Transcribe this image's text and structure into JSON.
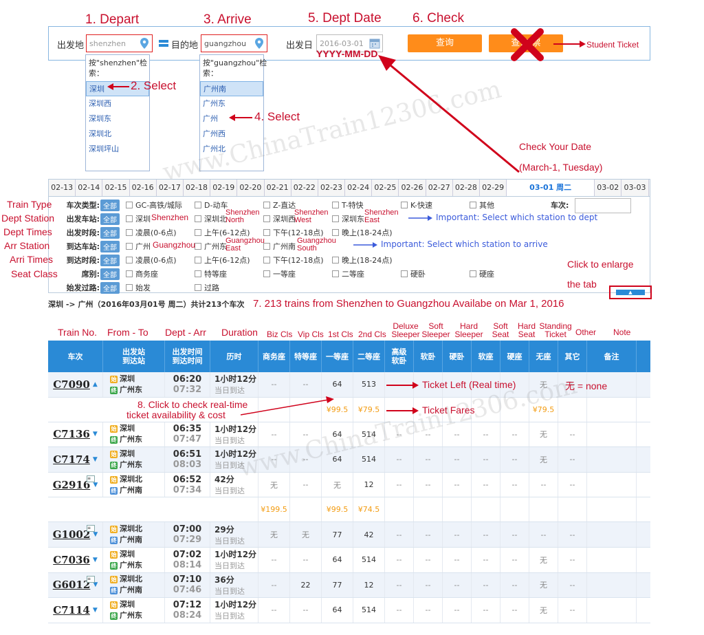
{
  "annotations": {
    "step1": "1. Depart",
    "step2": "2. Select",
    "step3": "3. Arrive",
    "step4": "4. Select",
    "step5": "5. Dept Date",
    "step6": "6. Check",
    "student_ticket": "Student Ticket",
    "date_format": "YYYY-MM-DD",
    "check_date_1": "Check Your  Date",
    "check_date_2": "(March-1, Tuesday)",
    "enlarge_1": "Click to enlarge",
    "enlarge_2": "the tab",
    "step7": "7.  213 trains from Shenzhen to Guangzhou Availabe on Mar 1, 2016",
    "step8_1": "8. Click to check real-time",
    "step8_2": "ticket availability & cost",
    "ticket_left": "Ticket Left (Real time)",
    "ticket_fares": "Ticket Fares",
    "none_mark": "无  =  none",
    "important_dept": "Important: Select which station to dept",
    "important_arr": "Important: Select which station to arrive",
    "row_labels": [
      "Train Type",
      "Dept Station",
      "Dept Times",
      "Arr Station",
      "Arri Times",
      "Seat Class"
    ],
    "station_notes": [
      "Shenzhen",
      "Shenzhen North",
      "Shenzhen West",
      "Shenzhen East",
      "Guangzhou",
      "Guangzhou East",
      "Guangzhou South"
    ],
    "col_notes": [
      "Train No.",
      "From - To",
      "Dept - Arr",
      "Duration",
      "Biz Cls",
      "Vip Cls",
      "1st Cls",
      "2nd Cls",
      "Deluxe Sleeper",
      "Soft Sleeper",
      "Hard Sleeper",
      "Soft Seat",
      "Hard Seat",
      "Standing Ticket",
      "Other",
      "Note"
    ],
    "watermark": "www.ChinaTrain12306.com"
  },
  "search": {
    "from_label": "出发地",
    "to_label": "目的地",
    "date_label": "出发日",
    "from_value": "shenzhen",
    "to_value": "guangzhou",
    "date_value": "2016-03-01",
    "query_button": "查询",
    "student_button": "查询学生票",
    "student_button_visible": "查询   票"
  },
  "from_dropdown": {
    "hint": "按\"shenzhen\"检索：",
    "items": [
      "深圳",
      "深圳西",
      "深圳东",
      "深圳北",
      "深圳坪山"
    ]
  },
  "to_dropdown": {
    "hint": "按\"guangzhou\"检索：",
    "items": [
      "广州南",
      "广州东",
      "广州",
      "广州西",
      "广州北"
    ]
  },
  "date_tabs": [
    "02-13",
    "02-14",
    "02-15",
    "02-16",
    "02-17",
    "02-18",
    "02-19",
    "02-20",
    "02-21",
    "02-22",
    "02-23",
    "02-24",
    "02-25",
    "02-26",
    "02-27",
    "02-28",
    "02-29",
    "03-01 周二",
    "03-02",
    "03-03"
  ],
  "filters": {
    "all": "全部",
    "train_type_label": "车次类型:",
    "train_types": [
      "GC-高铁/城际",
      "D-动车",
      "Z-直达",
      "T-特快",
      "K-快速",
      "其他"
    ],
    "train_no_label": "车次:",
    "dept_station_label": "出发车站:",
    "dept_stations": [
      "深圳",
      "深圳北",
      "深圳西",
      "深圳东"
    ],
    "dept_time_label": "出发时段:",
    "times": [
      "凌晨(0-6点)",
      "上午(6-12点)",
      "下午(12-18点)",
      "晚上(18-24点)"
    ],
    "arr_station_label": "到达车站:",
    "arr_stations": [
      "广州",
      "广州东",
      "广州南"
    ],
    "arr_time_label": "到达时段:",
    "seat_label": "席别:",
    "seats": [
      "商务座",
      "特等座",
      "一等座",
      "二等座",
      "硬卧",
      "硬座"
    ],
    "origin_label": "始发过路:",
    "origins": [
      "始发",
      "过路"
    ]
  },
  "summary": "深圳 -> 广州（2016年03月01号  周二）共计213个车次",
  "table": {
    "headers": [
      "车次",
      "出发站\n到达站",
      "出发时间\n到达时间",
      "历时",
      "商务座",
      "特等座",
      "一等座",
      "二等座",
      "高级\n软卧",
      "软卧",
      "硬卧",
      "软座",
      "硬座",
      "无座",
      "其它",
      "备注"
    ],
    "rows": [
      {
        "no": "C7090",
        "from": "深圳",
        "to": "广州东",
        "dep": "06:20",
        "arr": "07:32",
        "dur": "1小时12分",
        "day": "当日到达",
        "cells": [
          "--",
          "--",
          "64",
          "513",
          "",
          "",
          "",
          "",
          "",
          "无",
          "--",
          ""
        ]
      },
      {
        "price": true,
        "cells": [
          "",
          "",
          "¥99.5",
          "¥79.5",
          "",
          "",
          "",
          "",
          "",
          "¥79.5",
          "",
          ""
        ]
      },
      {
        "no": "C7136",
        "from": "深圳",
        "to": "广州东",
        "dep": "06:35",
        "arr": "07:47",
        "dur": "1小时12分",
        "day": "当日到达",
        "cells": [
          "--",
          "--",
          "64",
          "514",
          "--",
          "--",
          "--",
          "--",
          "--",
          "无",
          "--",
          ""
        ]
      },
      {
        "no": "C7174",
        "from": "深圳",
        "to": "广州东",
        "dep": "06:51",
        "arr": "08:03",
        "dur": "1小时12分",
        "day": "当日到达",
        "cells": [
          "--",
          "--",
          "64",
          "514",
          "--",
          "--",
          "--",
          "--",
          "--",
          "无",
          "--",
          ""
        ]
      },
      {
        "no": "G2916",
        "from": "深圳北",
        "to": "广州南",
        "dep": "06:52",
        "arr": "07:34",
        "dur": "42分",
        "day": "当日到达",
        "cells": [
          "无",
          "--",
          "无",
          "12",
          "--",
          "--",
          "--",
          "--",
          "--",
          "--",
          "--",
          ""
        ]
      },
      {
        "price": true,
        "cells": [
          "¥199.5",
          "",
          "¥99.5",
          "¥74.5",
          "",
          "",
          "",
          "",
          "",
          "",
          "",
          ""
        ]
      },
      {
        "no": "G1002",
        "from": "深圳北",
        "to": "广州南",
        "dep": "07:00",
        "arr": "07:29",
        "dur": "29分",
        "day": "当日到达",
        "cells": [
          "无",
          "无",
          "77",
          "42",
          "--",
          "--",
          "--",
          "--",
          "--",
          "--",
          "--",
          ""
        ]
      },
      {
        "no": "C7036",
        "from": "深圳",
        "to": "广州东",
        "dep": "07:02",
        "arr": "08:14",
        "dur": "1小时12分",
        "day": "当日到达",
        "cells": [
          "--",
          "--",
          "64",
          "514",
          "--",
          "--",
          "--",
          "--",
          "--",
          "无",
          "--",
          ""
        ]
      },
      {
        "no": "G6012",
        "from": "深圳北",
        "to": "广州南",
        "dep": "07:10",
        "arr": "07:46",
        "dur": "36分",
        "day": "当日到达",
        "cells": [
          "--",
          "22",
          "77",
          "12",
          "--",
          "--",
          "--",
          "--",
          "--",
          "无",
          "--",
          ""
        ]
      },
      {
        "no": "C7114",
        "from": "深圳",
        "to": "广州东",
        "dep": "07:12",
        "arr": "08:24",
        "dur": "1小时12分",
        "day": "当日到达",
        "cells": [
          "--",
          "--",
          "64",
          "514",
          "--",
          "--",
          "--",
          "--",
          "--",
          "无",
          "--",
          ""
        ]
      }
    ]
  }
}
